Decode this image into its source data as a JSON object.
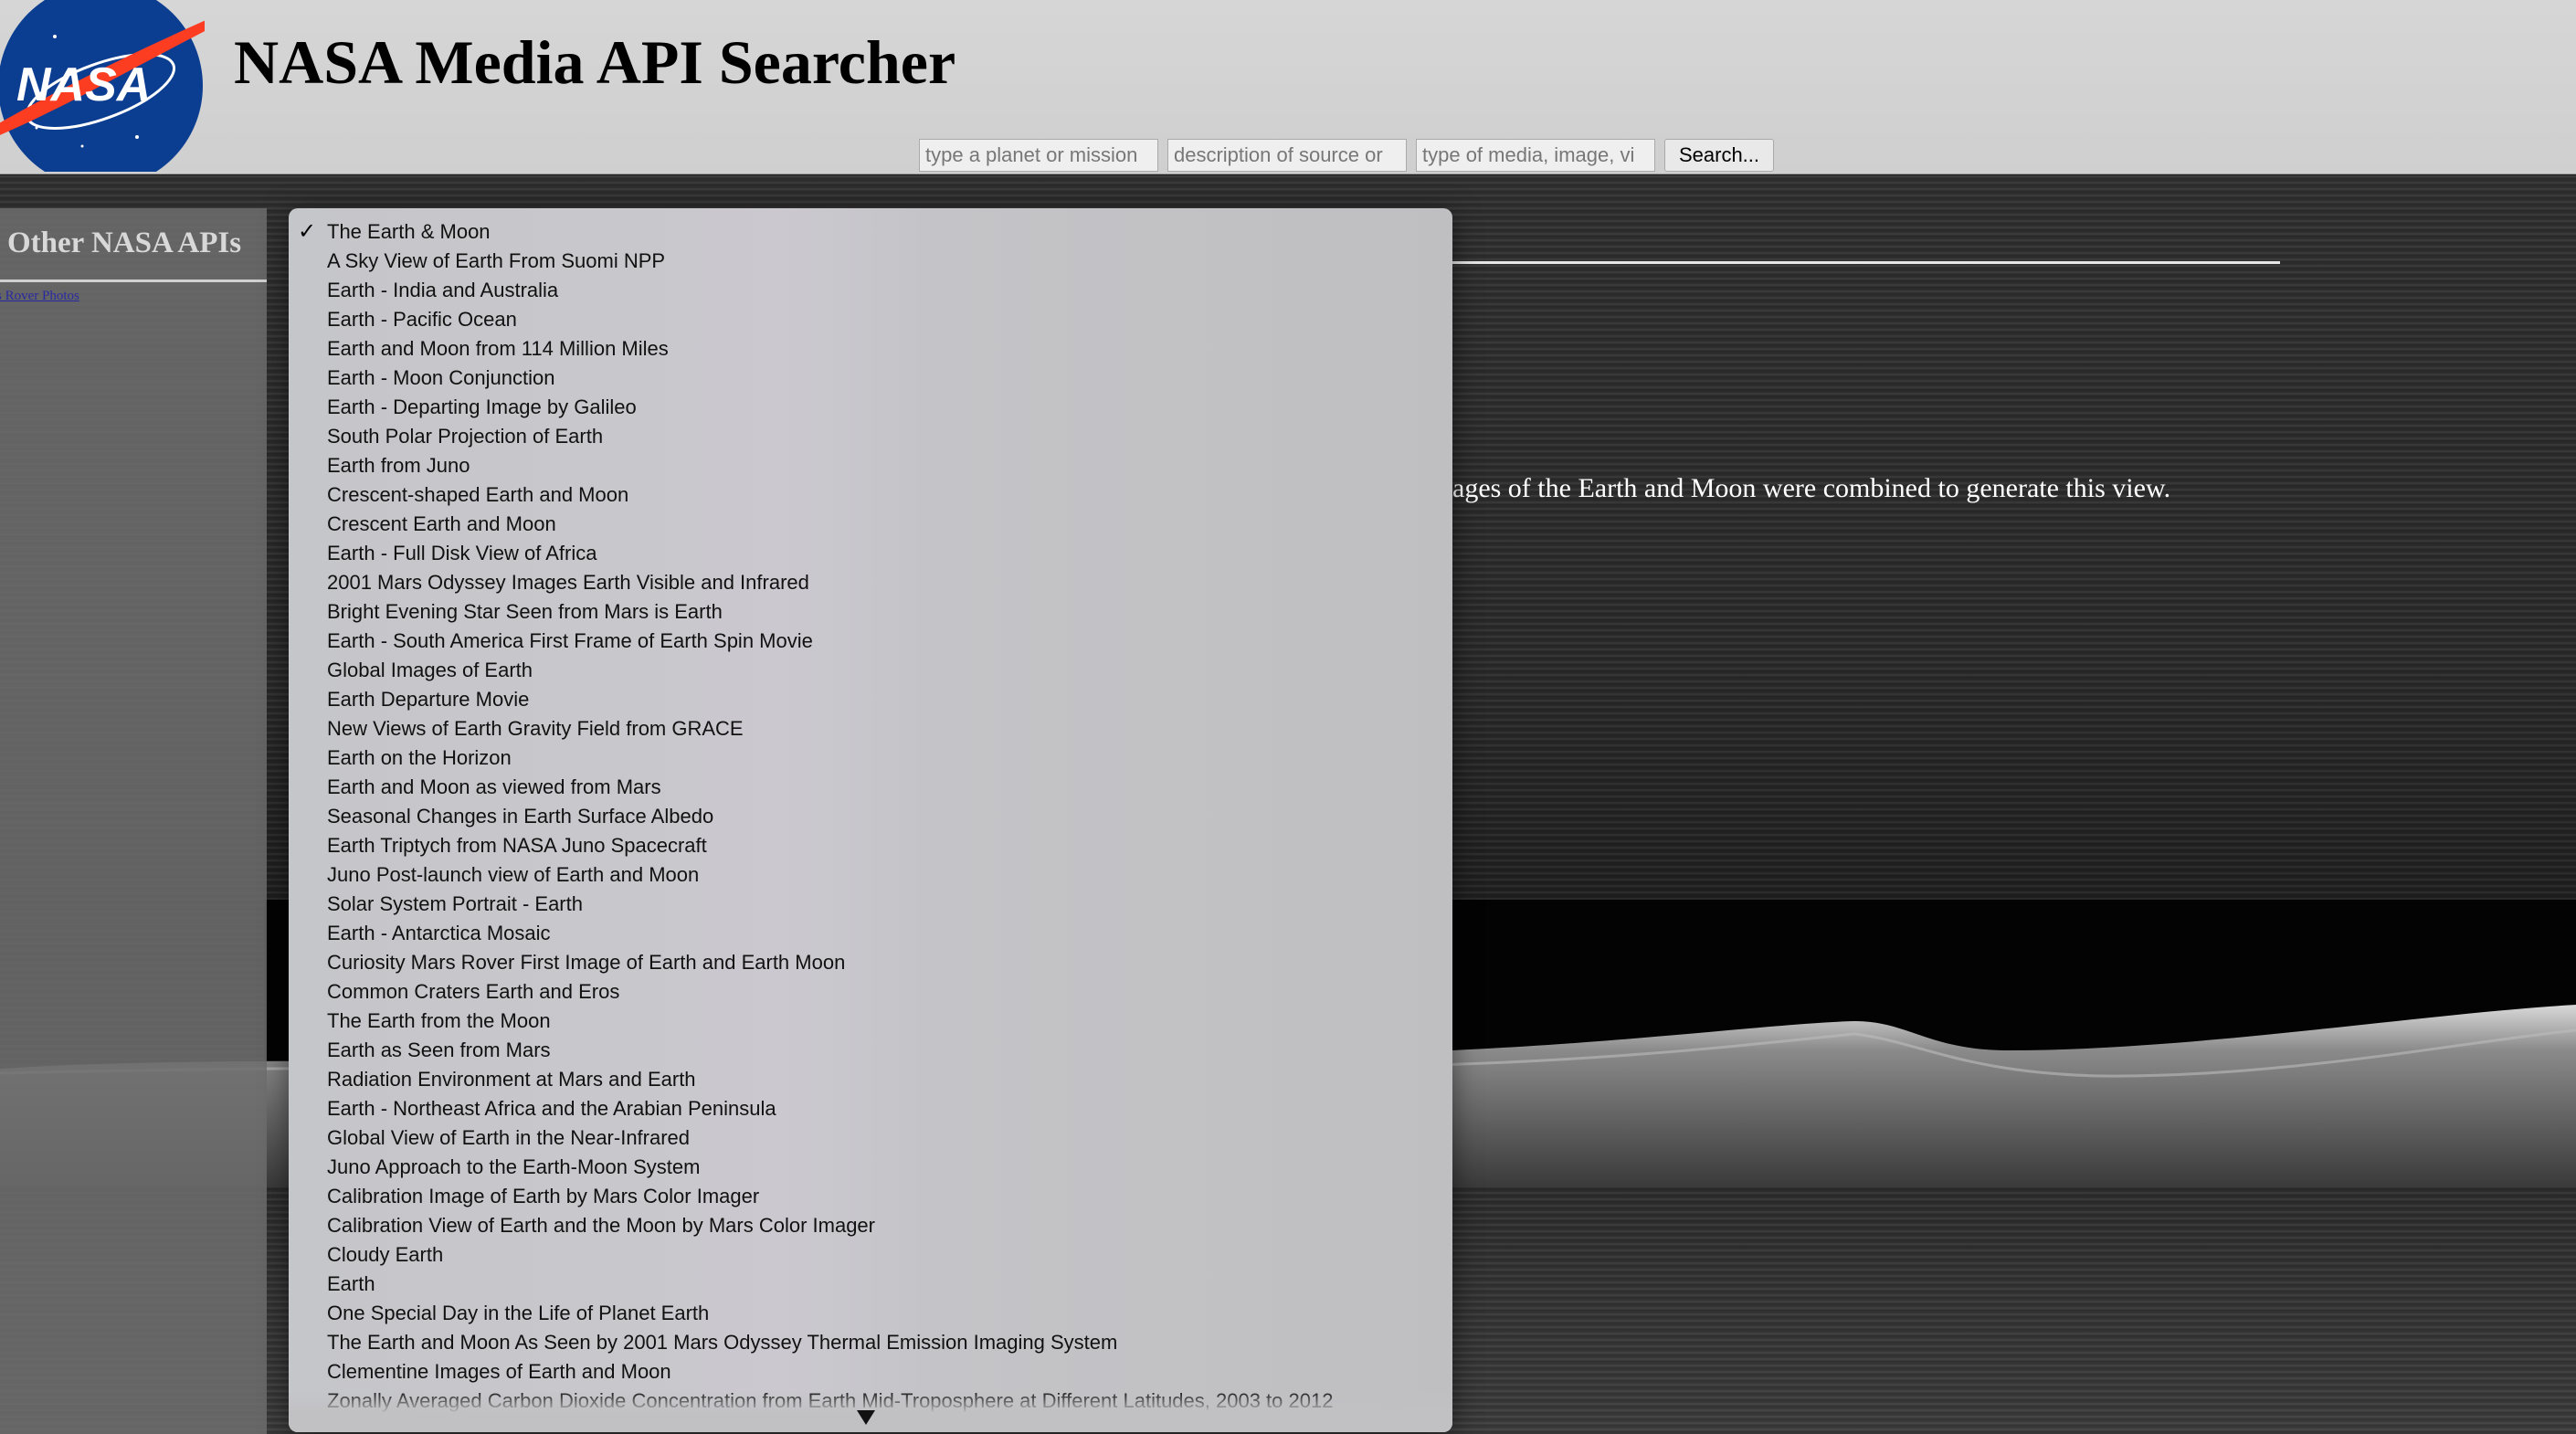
{
  "header": {
    "title": "NASA Media API Searcher",
    "logo_text": "NASA",
    "logo_icon": "nasa-meatball-logo"
  },
  "search": {
    "planet_placeholder": "type a planet or mission",
    "source_placeholder": "description of source or",
    "media_placeholder": "type of media, image, vi",
    "button_label": "Search..."
  },
  "sidebar": {
    "title": "Other NASA APIs",
    "link_label": "s Rover Photos"
  },
  "main": {
    "description_visible": "ages of the Earth and Moon were combined to generate this view."
  },
  "dropdown": {
    "selected_index": 0,
    "selected_icon": "checkmark-icon",
    "scroll_icon": "scroll-down-arrow-icon",
    "items": [
      "The Earth & Moon",
      "A Sky View of Earth From Suomi NPP",
      "Earth - India and Australia",
      "Earth - Pacific Ocean",
      "Earth and Moon from 114 Million Miles",
      "Earth - Moon Conjunction",
      "Earth - Departing Image by Galileo",
      "South Polar Projection of Earth",
      "Earth from Juno",
      "Crescent-shaped Earth and Moon",
      "Crescent Earth and Moon",
      "Earth - Full Disk View of Africa",
      "2001 Mars Odyssey Images Earth Visible and Infrared",
      "Bright Evening Star Seen from Mars is Earth",
      "Earth - South America First Frame of Earth Spin Movie",
      "Global Images of Earth",
      "Earth Departure Movie",
      "New Views of Earth Gravity Field from GRACE",
      "Earth on the Horizon",
      "Earth and Moon as viewed from Mars",
      "Seasonal Changes in Earth Surface Albedo",
      "Earth Triptych from NASA Juno Spacecraft",
      "Juno Post-launch view of Earth and Moon",
      "Solar System Portrait - Earth",
      "Earth - Antarctica Mosaic",
      "Curiosity Mars Rover First Image of Earth and Earth Moon",
      "Common Craters Earth and Eros",
      "The Earth from the Moon",
      "Earth as Seen from Mars",
      "Radiation Environment at Mars and Earth",
      "Earth - Northeast Africa and the Arabian Peninsula",
      "Global View of Earth in the Near-Infrared",
      "Juno Approach to the Earth-Moon System",
      "Calibration Image of Earth by Mars Color Imager",
      "Calibration View of Earth and the Moon by Mars Color Imager",
      "Cloudy Earth",
      "Earth",
      "One Special Day in the Life of Planet Earth",
      "The Earth and Moon As Seen by 2001 Mars Odyssey Thermal Emission Imaging System",
      "Clementine Images of Earth and Moon",
      "Zonally Averaged Carbon Dioxide Concentration from Earth Mid-Troposphere at Different Latitudes, 2003 to 2012"
    ]
  }
}
